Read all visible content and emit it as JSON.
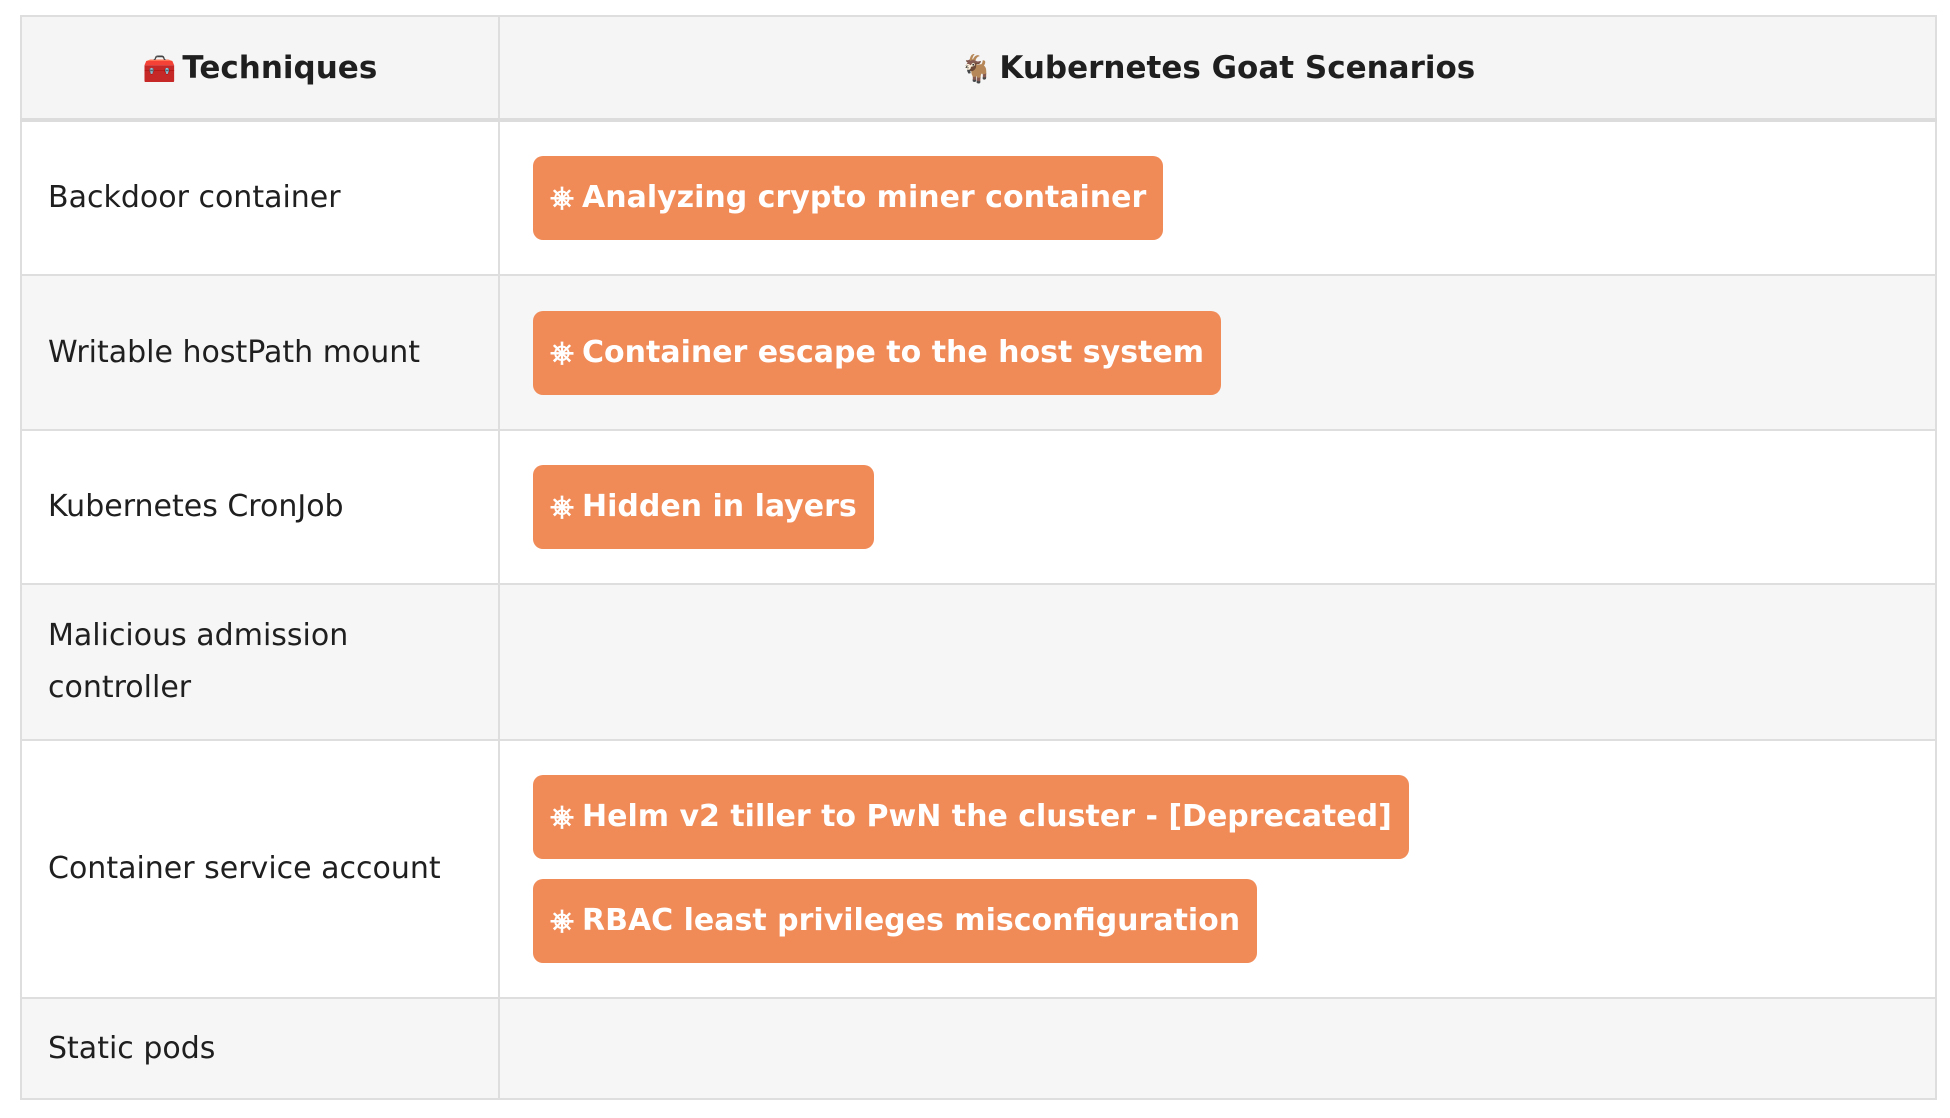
{
  "table": {
    "headers": {
      "techniques": {
        "icon": "toolbox-icon",
        "emoji": "🧰",
        "label": "Techniques"
      },
      "scenarios": {
        "icon": "goat-icon",
        "emoji": "🐐",
        "label": "Kubernetes Goat Scenarios"
      }
    },
    "scenario_icon": "⎈",
    "rows": [
      {
        "technique": "Backdoor container",
        "scenarios": [
          "Analyzing crypto miner container"
        ]
      },
      {
        "technique": "Writable hostPath mount",
        "scenarios": [
          "Container escape to the host system"
        ]
      },
      {
        "technique": "Kubernetes CronJob",
        "scenarios": [
          "Hidden in layers"
        ]
      },
      {
        "technique": "Malicious admission controller",
        "scenarios": []
      },
      {
        "technique": "Container service account",
        "scenarios": [
          "Helm v2 tiller to PwN the cluster - [Deprecated]",
          "RBAC least privileges misconfiguration"
        ]
      },
      {
        "technique": "Static pods",
        "scenarios": []
      }
    ]
  },
  "colors": {
    "pill_bg": "#f08a57",
    "pill_text": "#ffffff",
    "header_bg": "#f5f5f5",
    "stripe_bg": "#f6f6f6",
    "border": "#dedede"
  }
}
